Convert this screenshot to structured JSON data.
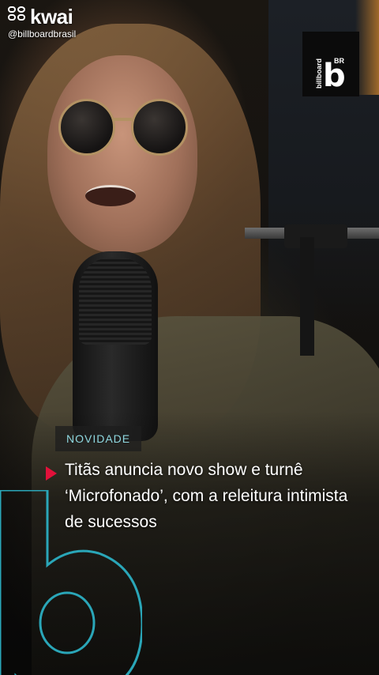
{
  "watermark": {
    "brand": "kwai",
    "handle": "@billboardbrasil"
  },
  "logo": {
    "vertical_text": "billboard",
    "region": "BR",
    "mark": "b"
  },
  "story": {
    "tag": "NOVIDADE",
    "headline": "Titãs anuncia novo show e turnê ‘Microfonado’, com a releitura intimista de sucessos"
  },
  "colors": {
    "tag_text": "#8fd8e0",
    "accent_triangle": "#e2113a",
    "brand_outline": "#2aa6b8"
  },
  "icons": {
    "kwai_logo": "kwai-logo-icon",
    "billboard_logo": "billboard-br-logo",
    "play_marker": "red-triangle-icon"
  }
}
